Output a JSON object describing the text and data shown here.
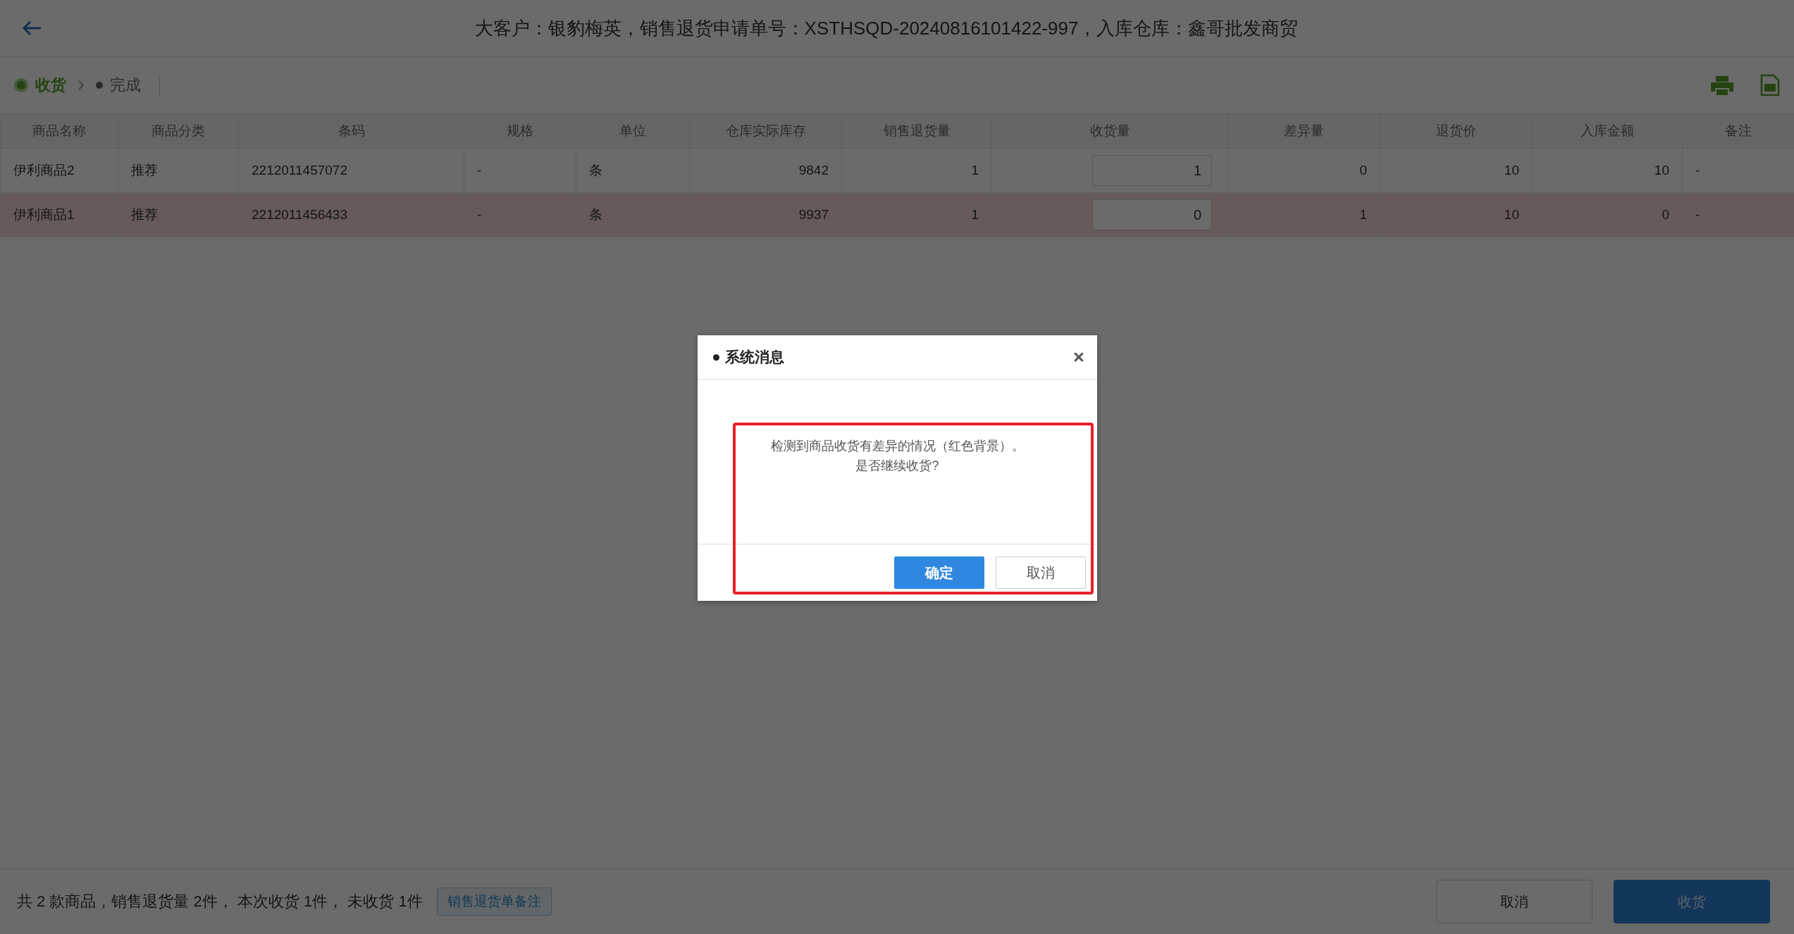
{
  "header": {
    "title": "大客户：银豹梅英，销售退货申请单号：XSTHSQD-20240816101422-997，入库仓库：鑫哥批发商贸"
  },
  "steps": [
    {
      "label": "收货",
      "selected": true
    },
    {
      "label": "完成",
      "selected": false
    }
  ],
  "table": {
    "columns": [
      {
        "label": "商品名称",
        "kind": "text"
      },
      {
        "label": "商品分类",
        "kind": "text"
      },
      {
        "label": "条码",
        "kind": "text"
      },
      {
        "label": "规格",
        "kind": "text"
      },
      {
        "label": "单位",
        "kind": "text"
      },
      {
        "label": "仓库实际库存",
        "kind": "number"
      },
      {
        "label": "销售退货量",
        "kind": "number"
      },
      {
        "label": "收货量",
        "kind": "input"
      },
      {
        "label": "差异量",
        "kind": "number"
      },
      {
        "label": "退货价",
        "kind": "number"
      },
      {
        "label": "入库金额",
        "kind": "number"
      },
      {
        "label": "备注",
        "kind": "text"
      }
    ],
    "rows": [
      {
        "discrepancy": false,
        "cells": [
          "伊利商品2",
          "推荐",
          "2212011457072",
          "-",
          "条",
          "9842",
          "1",
          "1",
          "0",
          "10",
          "10",
          "-"
        ]
      },
      {
        "discrepancy": true,
        "cells": [
          "伊利商品1",
          "推荐",
          "2212011456433",
          "-",
          "条",
          "9937",
          "1",
          "0",
          "1",
          "10",
          "0",
          "-"
        ]
      }
    ]
  },
  "footer": {
    "summary": "共 2 款商品，销售退货量 2件， 本次收货 1件， 未收货 1件",
    "note_button": "销售退货单备注",
    "buttons": [
      {
        "label": "取消",
        "kind": "secondary"
      },
      {
        "label": "收货",
        "kind": "primary"
      }
    ]
  },
  "dialog": {
    "title": "系统消息",
    "lines": [
      "检测到商品收货有差异的情况（红色背景）。",
      "是否继续收货?"
    ],
    "buttons": [
      {
        "label": "确定",
        "kind": "primary"
      },
      {
        "label": "取消",
        "kind": "secondary"
      }
    ]
  }
}
